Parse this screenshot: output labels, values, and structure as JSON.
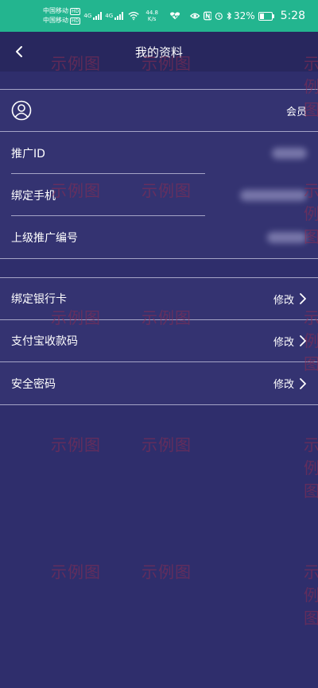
{
  "status_bar": {
    "carrier_1": "中国移动",
    "carrier_2": "中国移动",
    "hd_badge": "HD",
    "network_type": "4G",
    "net_speed": "44.8",
    "net_speed_unit": "K/s",
    "icons": [
      "wifi-icon",
      "heart-rate-icon",
      "eye-icon",
      "nfc-icon",
      "alarm-icon",
      "bluetooth-icon"
    ],
    "battery_percent": "32%",
    "battery_level": 0.32,
    "time": "5:28"
  },
  "header": {
    "title": "我的资料",
    "back_icon": "chevron-left-icon"
  },
  "profile": {
    "avatar_icon": "user-circle-icon",
    "role": "会员",
    "rows": [
      {
        "label": "推广ID"
      },
      {
        "label": "绑定手机"
      },
      {
        "label": "上级推广编号"
      }
    ]
  },
  "settings": {
    "rows": [
      {
        "label": "绑定银行卡",
        "action": "修改"
      },
      {
        "label": "支付宝收款码",
        "action": "修改"
      },
      {
        "label": "安全密码",
        "action": "修改"
      }
    ]
  },
  "watermark": "示例图",
  "colors": {
    "status_bar_bg": "#23b58f",
    "nav_bg": "#28275e",
    "page_bg": "#2f2e6c",
    "divider": "#a5a4c6"
  }
}
